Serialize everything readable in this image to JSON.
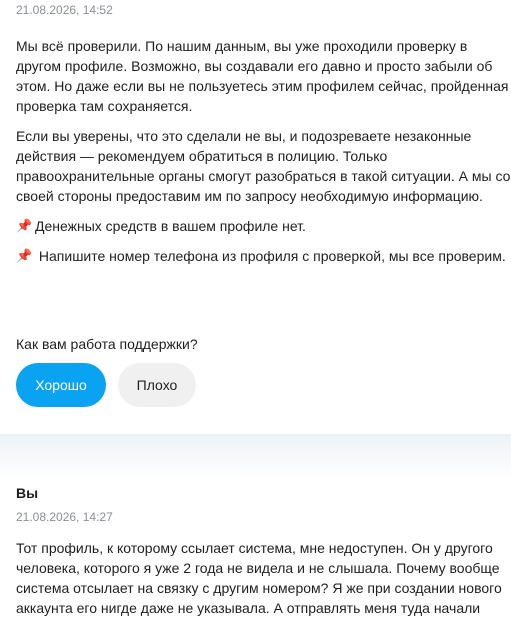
{
  "support_message": {
    "timestamp": "21.08.2026, 14:52",
    "paragraphs": [
      "Мы всё проверили. По нашим данным, вы уже проходили проверку в другом профиле. Возможно, вы создавали его давно и просто забыли об этом. Но даже если вы не пользуетесь этим профилем сейчас, пройденная проверка там сохраняется.",
      "Если вы уверены, что это сделали не вы, и подозреваете незаконные действия — рекомендуем обратиться в полицию. Только правоохранительные органы смогут разобраться в такой ситуации. А мы со своей стороны предоставим им по запросу необходимую информацию."
    ],
    "pin_lines": [
      {
        "icon": "pushpin-icon",
        "text": "Денежных средств в вашем профиле нет."
      },
      {
        "icon": "pushpin-icon",
        "text": " Напишите номер телефона из профиля с проверкой, мы все проверим."
      }
    ]
  },
  "feedback": {
    "question": "Как вам работа поддержки?",
    "good_label": "Хорошо",
    "bad_label": "Плохо",
    "accent_color": "#0aa3f2"
  },
  "user_message": {
    "sender": "Вы",
    "timestamp": "21.08.2026, 14:27",
    "text": "Тот профиль, к которому ссылает система, мне недоступен. Он у другого человека, которого я уже 2 года не видела и не слышала. Почему вообще система отсылает на связку с другим номером? Я же при создании нового аккаунта его нигде даже не указывала. А отправлять меня туда начали"
  }
}
